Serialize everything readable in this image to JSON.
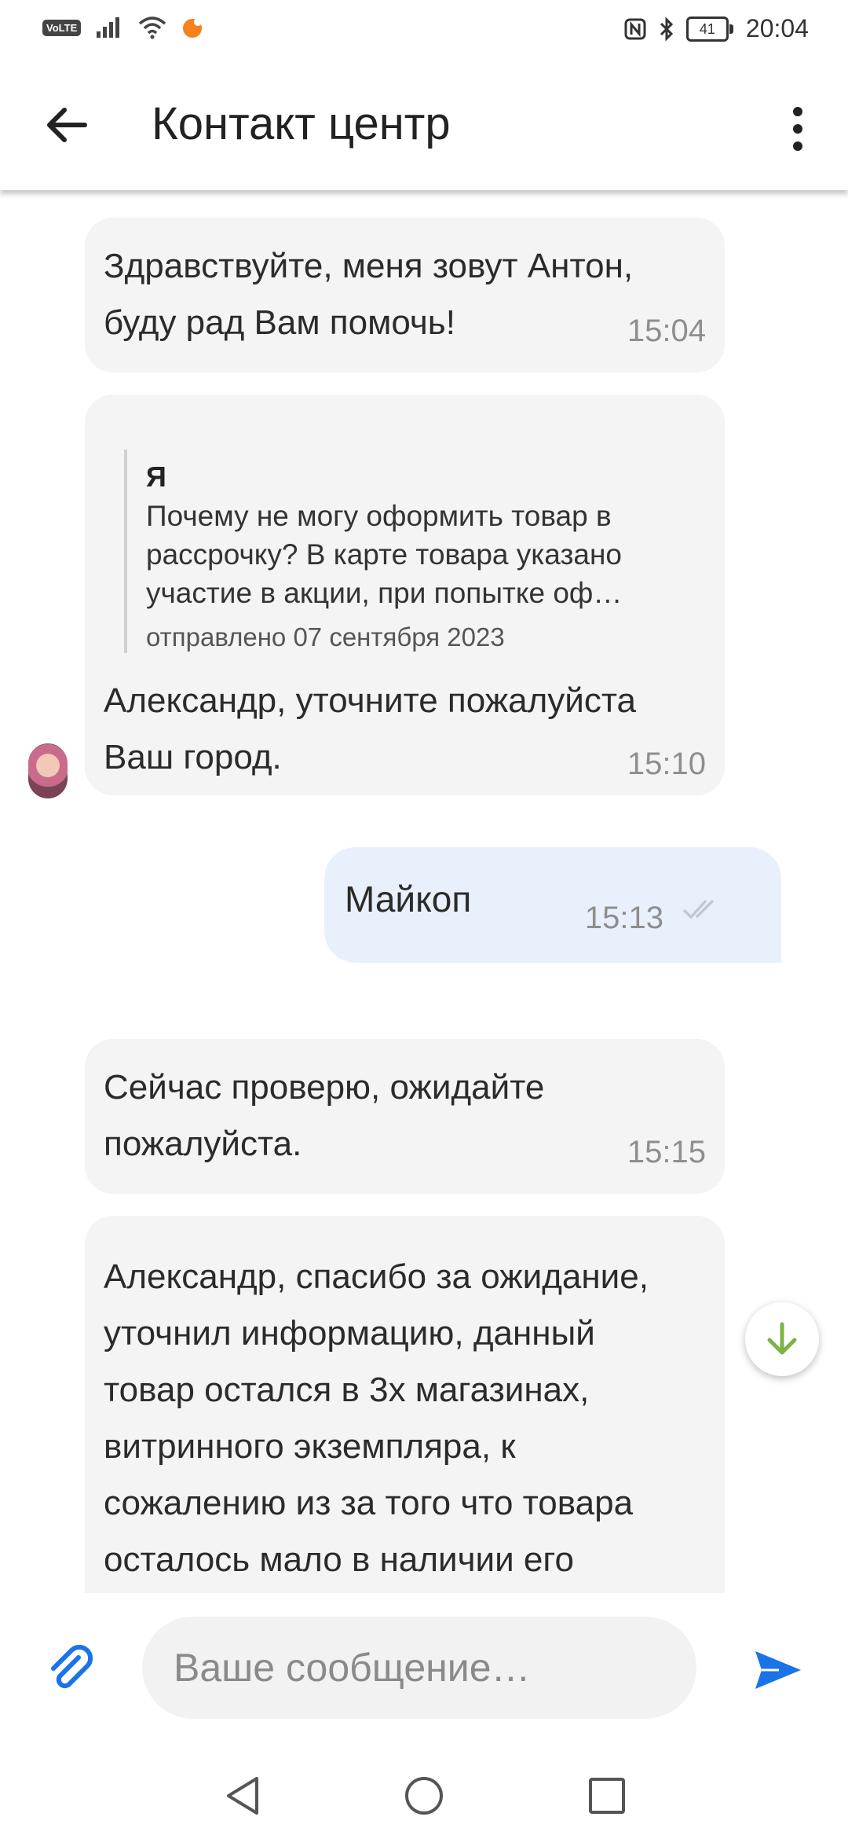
{
  "status_bar": {
    "volte": "VoLTE",
    "time": "20:04",
    "battery": "41"
  },
  "header": {
    "title": "Контакт центр"
  },
  "messages": [
    {
      "direction": "incoming",
      "text_lines": [
        "Здравствуйте, меня зовут Антон,",
        "буду рад Вам помочь!"
      ],
      "time": "15:04"
    },
    {
      "direction": "incoming",
      "quote": {
        "author": "Я",
        "text_lines": [
          "Почему не могу оформить товар в",
          "рассрочку? В карте товара указано",
          "участие в акции, при попытке оф…"
        ],
        "date": "отправлено 07 сентября 2023"
      },
      "text_lines": [
        "Александр, уточните пожалуйста",
        "Ваш город."
      ],
      "time": "15:10"
    },
    {
      "direction": "outgoing",
      "text_lines": [
        "Майкоп"
      ],
      "time": "15:13",
      "status": "read"
    },
    {
      "direction": "incoming",
      "text_lines": [
        "Сейчас проверю, ожидайте",
        "пожалуйста."
      ],
      "time": "15:15"
    },
    {
      "direction": "incoming",
      "text_lines": [
        "Александр, спасибо за ожидание,",
        "уточнил информацию, данный",
        "товар остался в 3х магазинах,",
        "витринного экземпляра, к",
        "сожалению из за того что товара",
        "осталось мало в наличии его"
      ]
    }
  ],
  "composer": {
    "placeholder": "Ваше сообщение…"
  },
  "colors": {
    "accent_blue": "#1a73e8",
    "incoming_bubble": "#f4f4f4",
    "outgoing_bubble": "#e8f0fc",
    "scroll_arrow_green": "#7cb342"
  }
}
